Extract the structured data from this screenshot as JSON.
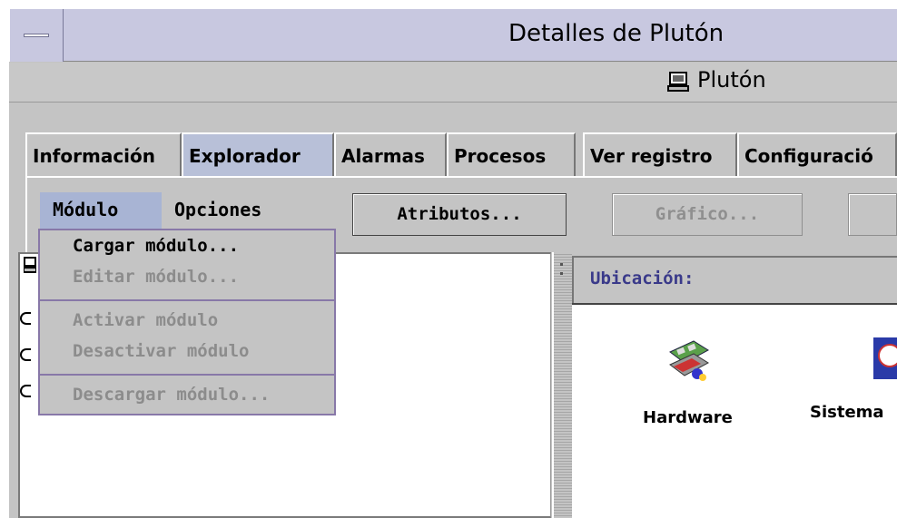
{
  "window": {
    "title": "Detalles de Plutón",
    "host": "Plutón"
  },
  "tabs": [
    {
      "label": "Información"
    },
    {
      "label": "Explorador"
    },
    {
      "label": "Alarmas"
    },
    {
      "label": "Procesos"
    },
    {
      "label": "Ver registro"
    },
    {
      "label": "Configuració"
    }
  ],
  "menubar": {
    "module": "Módulo",
    "options": "Opciones"
  },
  "buttons": {
    "attributes": "Atributos...",
    "graph": "Gráfico..."
  },
  "module_menu": {
    "load": "Cargar módulo...",
    "edit": "Editar módulo...",
    "enable": "Activar módulo",
    "disable": "Desactivar módulo",
    "unload": "Descargar módulo..."
  },
  "location": {
    "label": "Ubicación:"
  },
  "objects": {
    "hardware": "Hardware",
    "system": "Sistema"
  }
}
